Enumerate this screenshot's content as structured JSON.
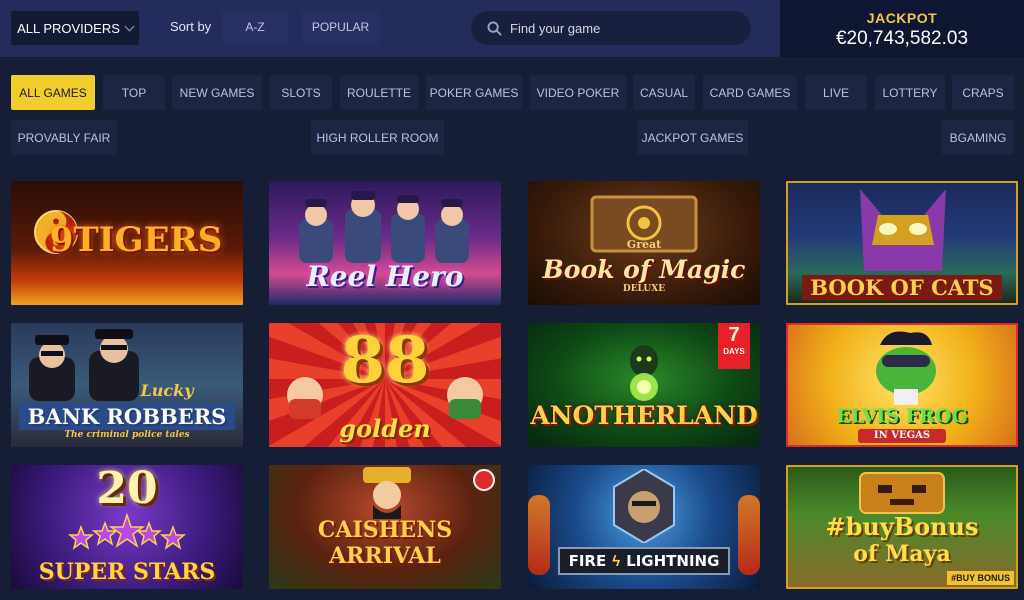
{
  "header": {
    "providers_label": "ALL PROVIDERS",
    "sort_label": "Sort by",
    "sort_options": [
      "A-Z",
      "POPULAR"
    ],
    "search_placeholder": "Find your game"
  },
  "jackpot": {
    "title": "JACKPOT",
    "amount": "€20,743,582.03"
  },
  "categories": [
    "ALL GAMES",
    "TOP",
    "NEW GAMES",
    "SLOTS",
    "ROULETTE",
    "POKER GAMES",
    "VIDEO POKER",
    "CASUAL",
    "CARD GAMES",
    "LIVE",
    "LOTTERY",
    "CRAPS",
    "PROVABLY FAIR",
    "HIGH ROLLER ROOM",
    "JACKPOT GAMES",
    "BGAMING"
  ],
  "active_category": "ALL GAMES",
  "games": [
    {
      "title": "9TIGERS",
      "icon": "yin-yang-icon"
    },
    {
      "title": "Reel Hero",
      "icon": "cyborg-characters"
    },
    {
      "title": "Book of Magic",
      "line1": "Great",
      "line3": "DELUXE",
      "icon": "magic-book-icon"
    },
    {
      "title": "BOOK OF CATS",
      "icon": "cat-mask-icon"
    },
    {
      "title": "BANK ROBBERS",
      "line1": "Lucky",
      "line3": "The criminal police tales",
      "icon": "robbers-icon"
    },
    {
      "title": "88",
      "line2": "golden",
      "icon": "golden-88-icon"
    },
    {
      "title": "ANOTHERLAND",
      "badge_number": "7",
      "badge_text": "DAYS",
      "icon": "orb-icon"
    },
    {
      "title": "ELVIS FROG",
      "line3": "IN VEGAS",
      "icon": "frog-icon"
    },
    {
      "title": "20",
      "line2": "SUPER STARS",
      "icon": "star-icon"
    },
    {
      "title": "CAISHENS",
      "line2": "ARRIVAL",
      "icon": "caishen-icon"
    },
    {
      "title": "FIRE",
      "line2": "LIGHTNING",
      "icon": "lightning-icon"
    },
    {
      "title": "#buyBonus",
      "line2": "of Maya",
      "badge_text": "#BUY BONUS",
      "icon": "maya-mask-icon"
    }
  ],
  "colors": {
    "accent": "#f2cd2c",
    "background": "#161e36",
    "topbar": "#232c5a",
    "jackpot_gold": "#f5c842"
  }
}
